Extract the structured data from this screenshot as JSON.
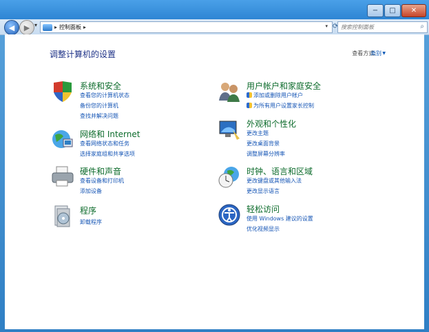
{
  "address": {
    "crumbs": [
      "控制面板"
    ]
  },
  "search": {
    "placeholder": "搜索控制面板"
  },
  "main": {
    "title": "调整计算机的设置",
    "view_label": "查看方式:",
    "view_value": "类别"
  },
  "categories": [
    {
      "title": "系统和安全",
      "links": [
        "查看您的计算机状态",
        "备份您的计算机",
        "查找并解决问题"
      ]
    },
    {
      "title": "网络和 Internet",
      "links": [
        "查看网络状态和任务",
        "选择家庭组和共享选项"
      ]
    },
    {
      "title": "硬件和声音",
      "links": [
        "查看设备和打印机",
        "添加设备"
      ]
    },
    {
      "title": "程序",
      "links": [
        "卸载程序"
      ]
    },
    {
      "title": "用户帐户和家庭安全",
      "links": [
        "添加或删除用户帐户",
        "为所有用户设置家长控制"
      ]
    },
    {
      "title": "外观和个性化",
      "links": [
        "更改主题",
        "更改桌面背景",
        "调整屏幕分辨率"
      ]
    },
    {
      "title": "时钟、语言和区域",
      "links": [
        "更改键盘或其他输入法",
        "更改显示语言"
      ]
    },
    {
      "title": "轻松访问",
      "links": [
        "使用 Windows 建议的设置",
        "优化视频显示"
      ]
    }
  ],
  "colors": {
    "title_green": "#0c6b2b",
    "link_blue": "#1555b5",
    "heading_blue": "#1e3287"
  }
}
